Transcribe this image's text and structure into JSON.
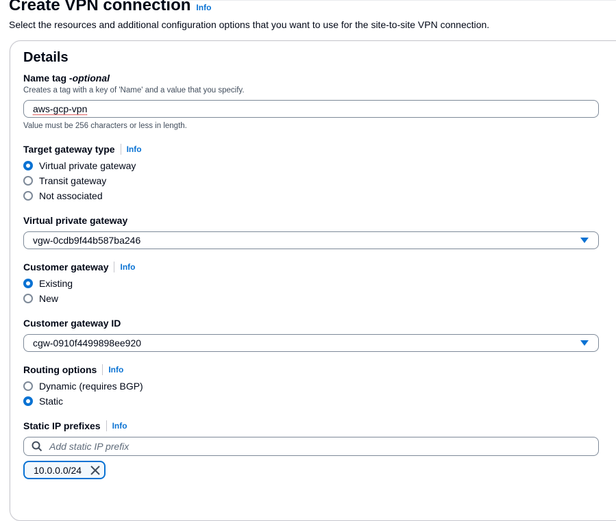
{
  "header": {
    "title": "Create VPN connection",
    "info": "Info",
    "description": "Select the resources and additional configuration options that you want to use for the site-to-site VPN connection."
  },
  "details": {
    "heading": "Details",
    "name_tag": {
      "label": "Name tag - ",
      "optional": "optional",
      "hint": "Creates a tag with a key of 'Name' and a value that you specify.",
      "value": "aws-gcp-vpn",
      "constraint": "Value must be 256 characters or less in length."
    },
    "target_gateway": {
      "label": "Target gateway type",
      "info": "Info",
      "options": [
        "Virtual private gateway",
        "Transit gateway",
        "Not associated"
      ],
      "selected": "Virtual private gateway"
    },
    "virtual_private_gateway": {
      "label": "Virtual private gateway",
      "value": "vgw-0cdb9f44b587ba246"
    },
    "customer_gateway": {
      "label": "Customer gateway",
      "info": "Info",
      "options": [
        "Existing",
        "New"
      ],
      "selected": "Existing"
    },
    "customer_gateway_id": {
      "label": "Customer gateway ID",
      "value": "cgw-0910f4499898ee920"
    },
    "routing": {
      "label": "Routing options",
      "info": "Info",
      "options": [
        "Dynamic (requires BGP)",
        "Static"
      ],
      "selected": "Static"
    },
    "static_prefixes": {
      "label": "Static IP prefixes",
      "info": "Info",
      "placeholder": "Add static IP prefix",
      "tokens": [
        "10.0.0.0/24"
      ]
    }
  },
  "colors": {
    "accent": "#0972d3",
    "text": "#000716",
    "border": "#7d8998"
  }
}
